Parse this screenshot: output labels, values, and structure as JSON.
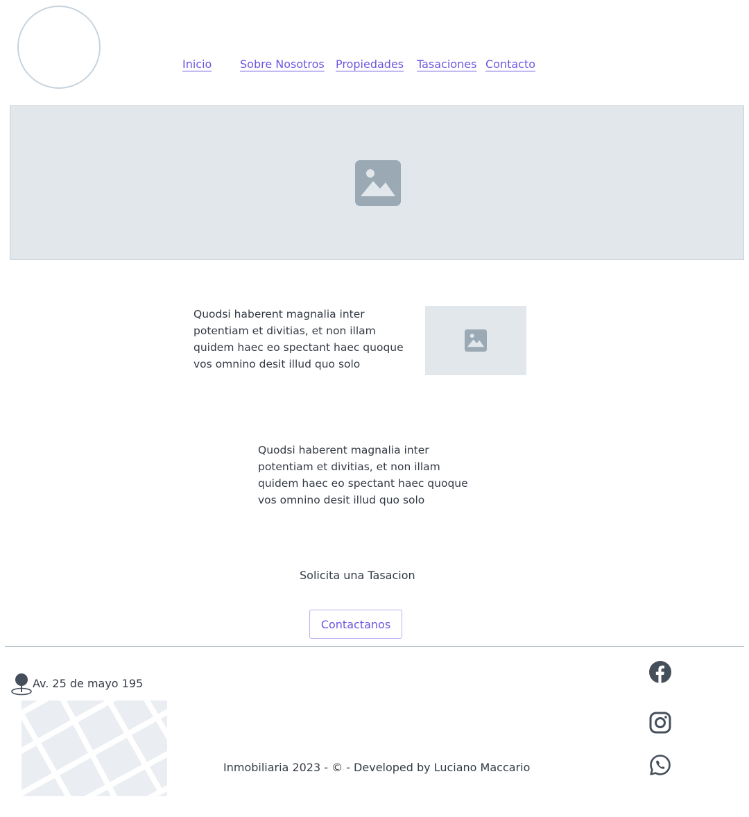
{
  "header": {
    "nav": [
      {
        "label": "Inicio"
      },
      {
        "label": "Sobre Nosotros"
      },
      {
        "label": "Propiedades"
      },
      {
        "label": "Tasaciones"
      },
      {
        "label": "Contacto"
      }
    ]
  },
  "content": {
    "paragraph_1": "Quodsi haberent magnalia inter potentiam et divitias, et non illam quidem haec eo spectant haec quoque vos omnino desit illud quo solo",
    "paragraph_2": "Quodsi haberent magnalia inter potentiam et divitias, et non illam quidem haec eo spectant haec quoque vos omnino desit illud quo solo",
    "cta_text": "Solicita una Tasacion",
    "cta_button": "Contactanos"
  },
  "footer": {
    "address": "Av. 25 de mayo 195",
    "copyright": "Inmobiliaria 2023 - © - Developed by Luciano Maccario",
    "social": [
      "facebook-icon",
      "instagram-icon",
      "whatsapp-icon"
    ]
  },
  "colors": {
    "link": "#6b55e0",
    "placeholder_bg": "#e1e7eb",
    "placeholder_icon": "#9aa9b4",
    "footer_icon": "#454f5b"
  }
}
